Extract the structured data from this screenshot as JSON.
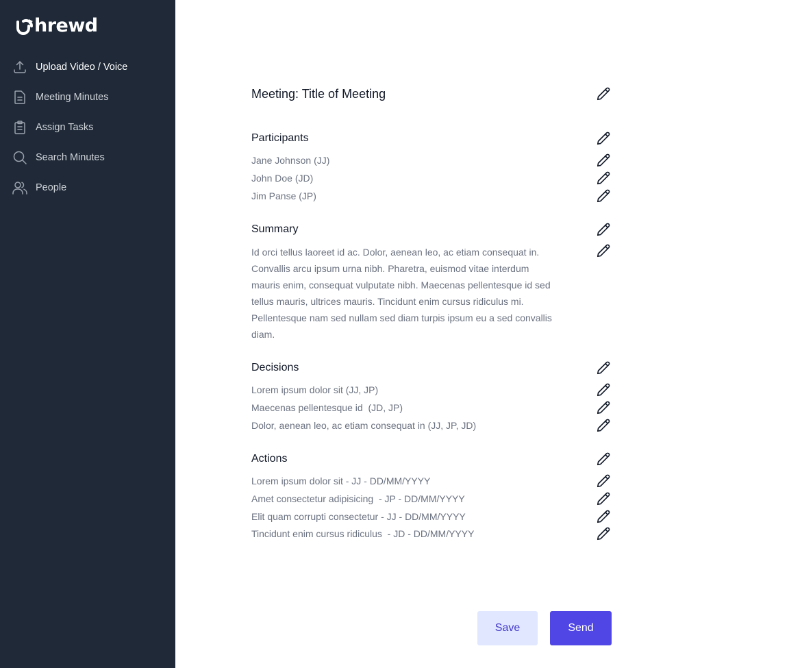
{
  "app": {
    "logo_text": "hrewd"
  },
  "sidebar": {
    "items": [
      {
        "label": "Upload Video / Voice",
        "icon": "upload-icon",
        "active": true
      },
      {
        "label": "Meeting Minutes",
        "icon": "document-icon"
      },
      {
        "label": "Assign Tasks",
        "icon": "clipboard-icon"
      },
      {
        "label": "Search Minutes",
        "icon": "search-icon"
      },
      {
        "label": "People",
        "icon": "people-icon"
      }
    ]
  },
  "meeting": {
    "title": "Meeting: Title of Meeting",
    "participants": {
      "heading": "Participants",
      "items": [
        "Jane Johnson (JJ)",
        "John Doe (JD)",
        "Jim Panse (JP)"
      ]
    },
    "summary": {
      "heading": "Summary",
      "text": "Id orci tellus laoreet id ac. Dolor, aenean leo, ac etiam consequat in. Convallis arcu ipsum urna nibh. Pharetra, euismod vitae interdum mauris enim, consequat vulputate nibh. Maecenas pellentesque id sed tellus mauris, ultrices mauris. Tincidunt enim cursus ridiculus mi. Pellentesque nam sed nullam sed diam turpis ipsum eu a sed convallis diam."
    },
    "decisions": {
      "heading": "Decisions",
      "items": [
        "Lorem ipsum dolor sit (JJ, JP)",
        "Maecenas pellentesque id  (JD, JP)",
        "Dolor, aenean leo, ac etiam consequat in (JJ, JP, JD)"
      ]
    },
    "actions": {
      "heading": "Actions",
      "items": [
        "Lorem ipsum dolor sit - JJ - DD/MM/YYYY",
        "Amet consectetur adipisicing  - JP - DD/MM/YYYY",
        "Elit quam corrupti consectetur - JJ - DD/MM/YYYY",
        "Tincidunt enim cursus ridiculus  - JD - DD/MM/YYYY"
      ]
    }
  },
  "buttons": {
    "save": "Save",
    "send": "Send"
  },
  "colors": {
    "sidebar_bg": "#1f2937",
    "primary": "#4f46e5",
    "secondary_bg": "#e0e7ff",
    "secondary_text": "#4338ca"
  }
}
